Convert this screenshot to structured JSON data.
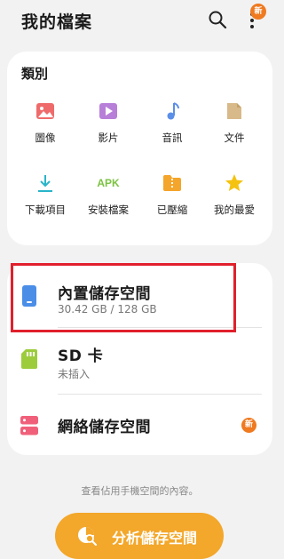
{
  "header": {
    "title": "我的檔案",
    "new_badge": "新"
  },
  "categories": {
    "title": "類別",
    "items": [
      {
        "label": "圖像",
        "icon": "image-icon",
        "color": "#ef6b6b"
      },
      {
        "label": "影片",
        "icon": "video-icon",
        "color": "#b87fd9"
      },
      {
        "label": "音訊",
        "icon": "audio-icon",
        "color": "#5b8fe8"
      },
      {
        "label": "文件",
        "icon": "document-icon",
        "color": "#d8b98a"
      },
      {
        "label": "下載項目",
        "icon": "download-icon",
        "color": "#2ab5c9"
      },
      {
        "label": "安裝檔案",
        "icon": "apk-icon",
        "icon_text": "APK",
        "color": "#7cc242"
      },
      {
        "label": "已壓縮",
        "icon": "compressed-icon",
        "color": "#f4a52b"
      },
      {
        "label": "我的最愛",
        "icon": "star-icon",
        "color": "#f5c20f"
      }
    ]
  },
  "storage": [
    {
      "title": "內置儲存空間",
      "subtitle": "30.42 GB / 128 GB",
      "icon": "phone-storage-icon",
      "color": "#4a8ee8"
    },
    {
      "title": "SD 卡",
      "subtitle": "未插入",
      "icon": "sd-card-icon",
      "color": "#9ccc3c"
    },
    {
      "title": "網絡儲存空間",
      "badge": "新",
      "icon": "network-storage-icon",
      "color": "#f0607a"
    }
  ],
  "footer": {
    "hint": "查看佔用手機空間的內容。",
    "analyze_button": "分析儲存空間"
  }
}
